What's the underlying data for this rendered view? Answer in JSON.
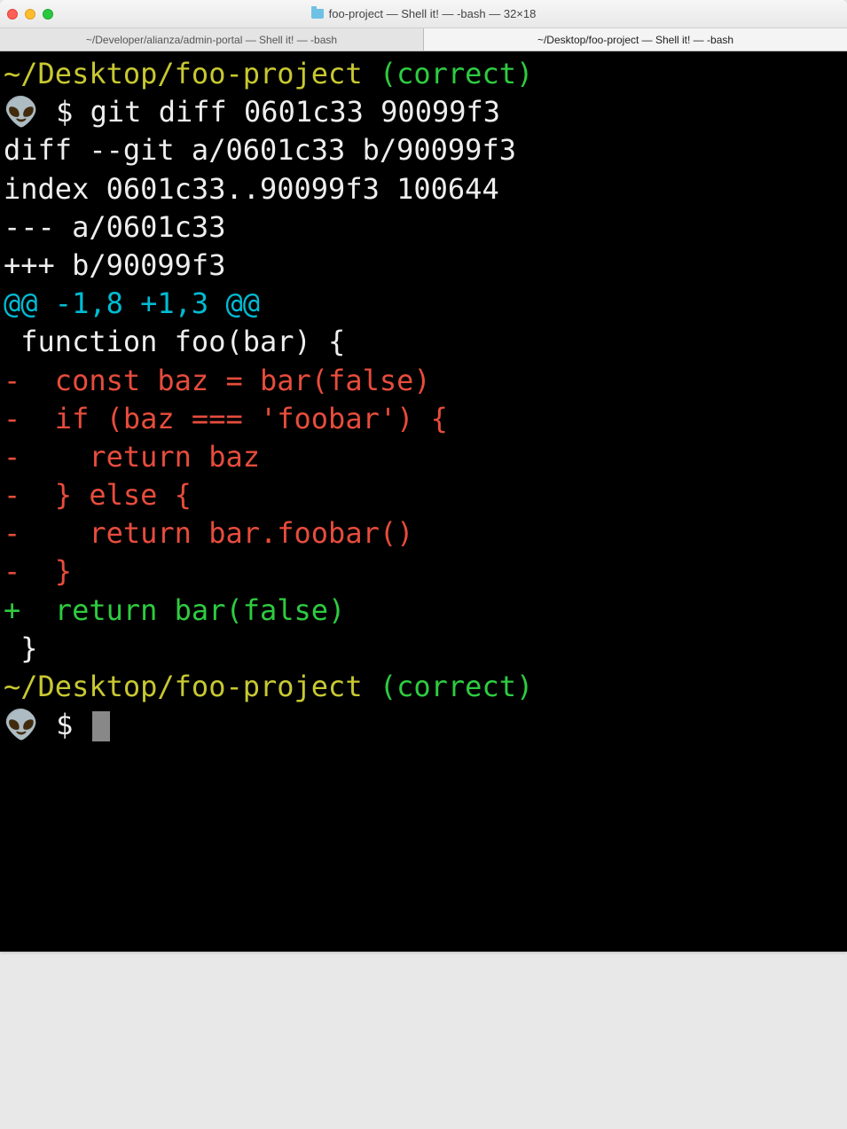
{
  "window": {
    "title": "foo-project — Shell it! — -bash — 32×18"
  },
  "tabs": [
    {
      "label": "~/Developer/alianza/admin-portal — Shell it! — -bash",
      "active": false
    },
    {
      "label": "~/Desktop/foo-project — Shell it! — -bash",
      "active": true
    }
  ],
  "terminal": {
    "prompt_path": "~/Desktop/foo-project",
    "branch": "(correct)",
    "prompt_icon": "👽",
    "prompt_symbol": "$",
    "command": "git diff 0601c33 90099f3",
    "diff_header_1": "diff --git a/0601c33 b/90099f3",
    "diff_header_2": "index 0601c33..90099f3 100644",
    "diff_header_3": "--- a/0601c33",
    "diff_header_4": "+++ b/90099f3",
    "hunk": "@@ -1,8 +1,3 @@",
    "context_1": " function foo(bar) {",
    "del_1": "-  const baz = bar(false)",
    "del_2": "-  if (baz === 'foobar') {",
    "del_3": "-    return baz",
    "del_4": "-  } else {",
    "del_5": "-    return bar.foobar()",
    "del_6": "-  }",
    "add_1": "+  return bar(false)",
    "context_2": " }"
  }
}
